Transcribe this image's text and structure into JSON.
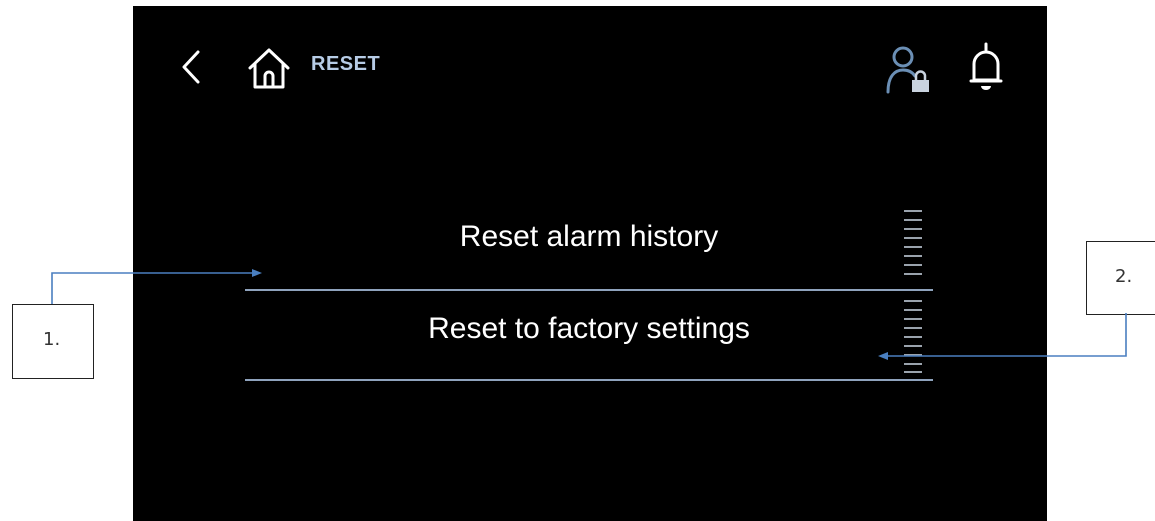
{
  "header": {
    "back_icon": "chevron-left-icon",
    "home_icon": "home-icon",
    "breadcrumb": "RESET",
    "user_icon": "user-lock-icon",
    "bell_icon": "bell-icon"
  },
  "menu": {
    "items": [
      {
        "label": "Reset alarm history"
      },
      {
        "label": "Reset to factory settings"
      }
    ]
  },
  "callouts": {
    "one": "1.",
    "two": "2."
  },
  "colors": {
    "screen_bg": "#000000",
    "accent": "#b7cce6",
    "divider": "#8fa3bd",
    "callout_arrow": "#4a7fc0"
  }
}
